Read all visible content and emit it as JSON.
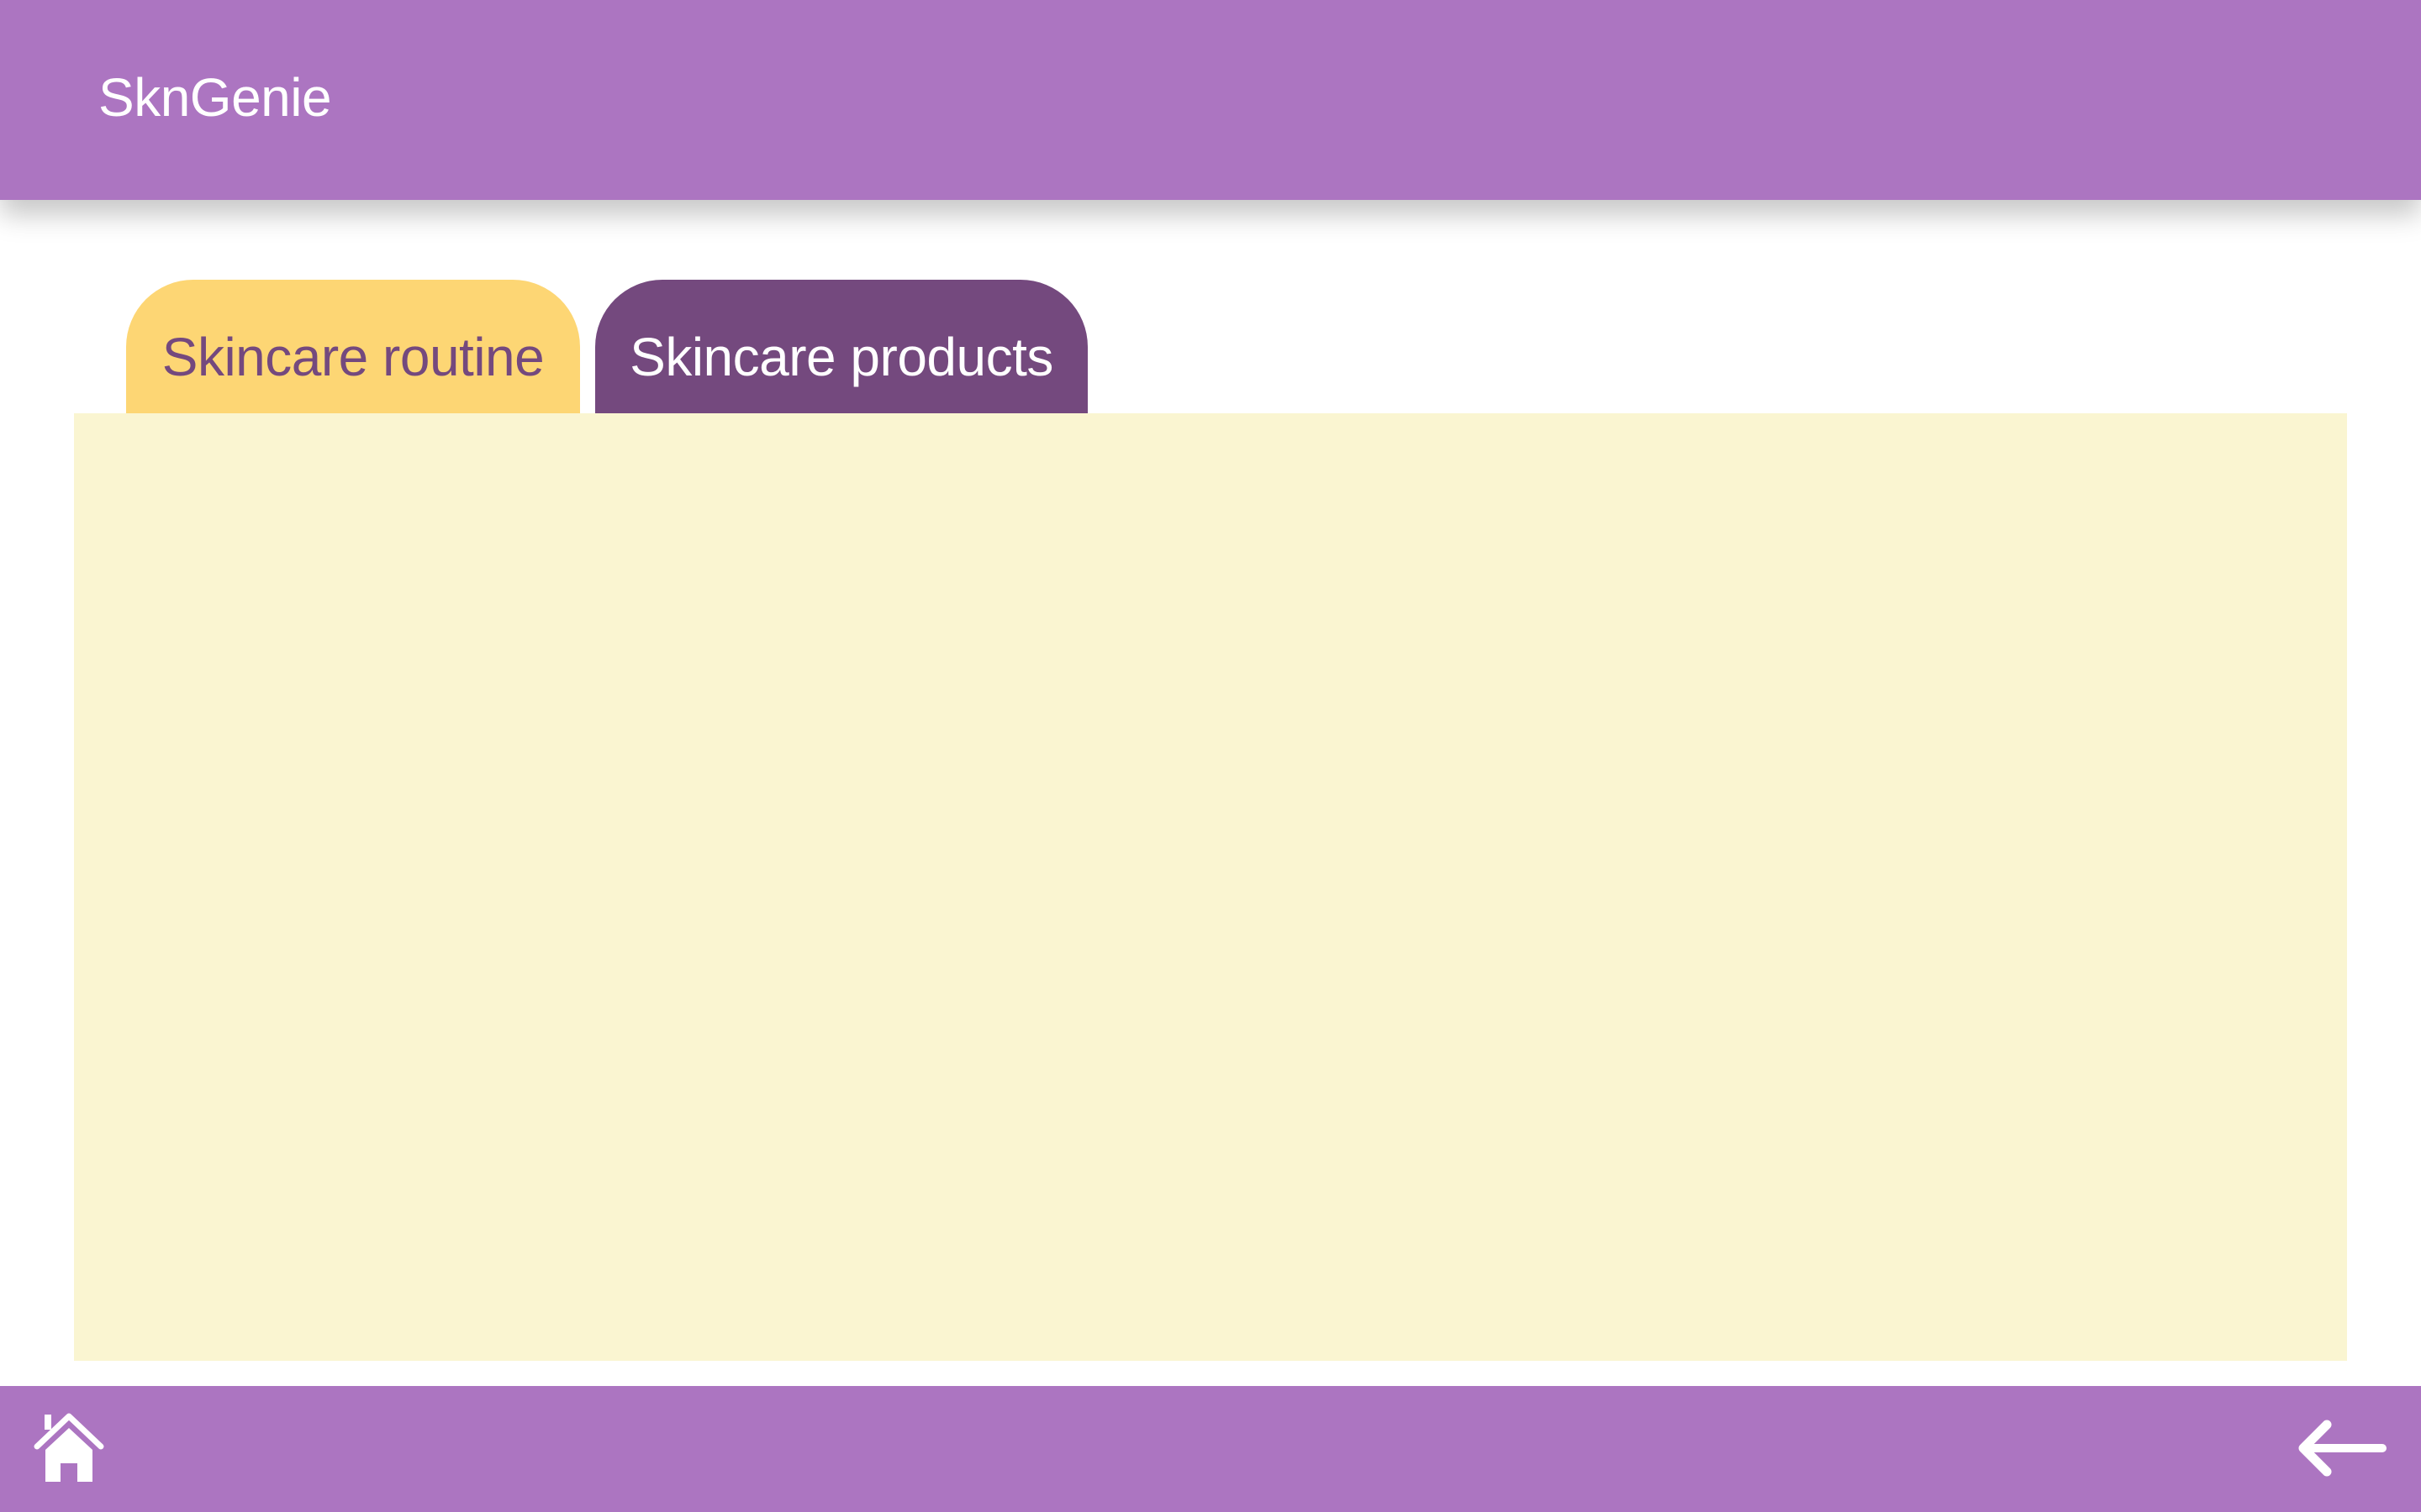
{
  "app": {
    "title": "SknGenie"
  },
  "tabs": [
    {
      "label": "Skincare routine",
      "color": "#FDD674",
      "text_color": "#74497E"
    },
    {
      "label": "Skincare products",
      "color": "#74497E",
      "text_color": "#FFFFFF",
      "selected": true
    }
  ],
  "content": {
    "background": "#FAF5D1"
  },
  "bottom_bar": {
    "home_icon": "home-icon",
    "back_icon": "arrow-left-icon"
  },
  "colors": {
    "primary": "#AC75C1",
    "dark_purple": "#74497E",
    "yellow": "#FDD674",
    "cream": "#FAF5D1"
  }
}
